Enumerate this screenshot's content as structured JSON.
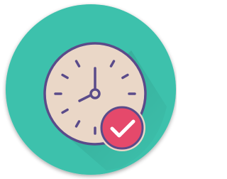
{
  "icon": {
    "name": "clock-check-icon",
    "badge_icon": "checkmark-icon"
  },
  "colors": {
    "background": "#ffffff",
    "circle_teal": "#3ec1ac",
    "circle_shadow": "#2a8f80",
    "clock_face": "#ead7c7",
    "clock_outline": "#5a4b8a",
    "badge_red": "#e5496b",
    "checkmark": "#ffffff"
  }
}
